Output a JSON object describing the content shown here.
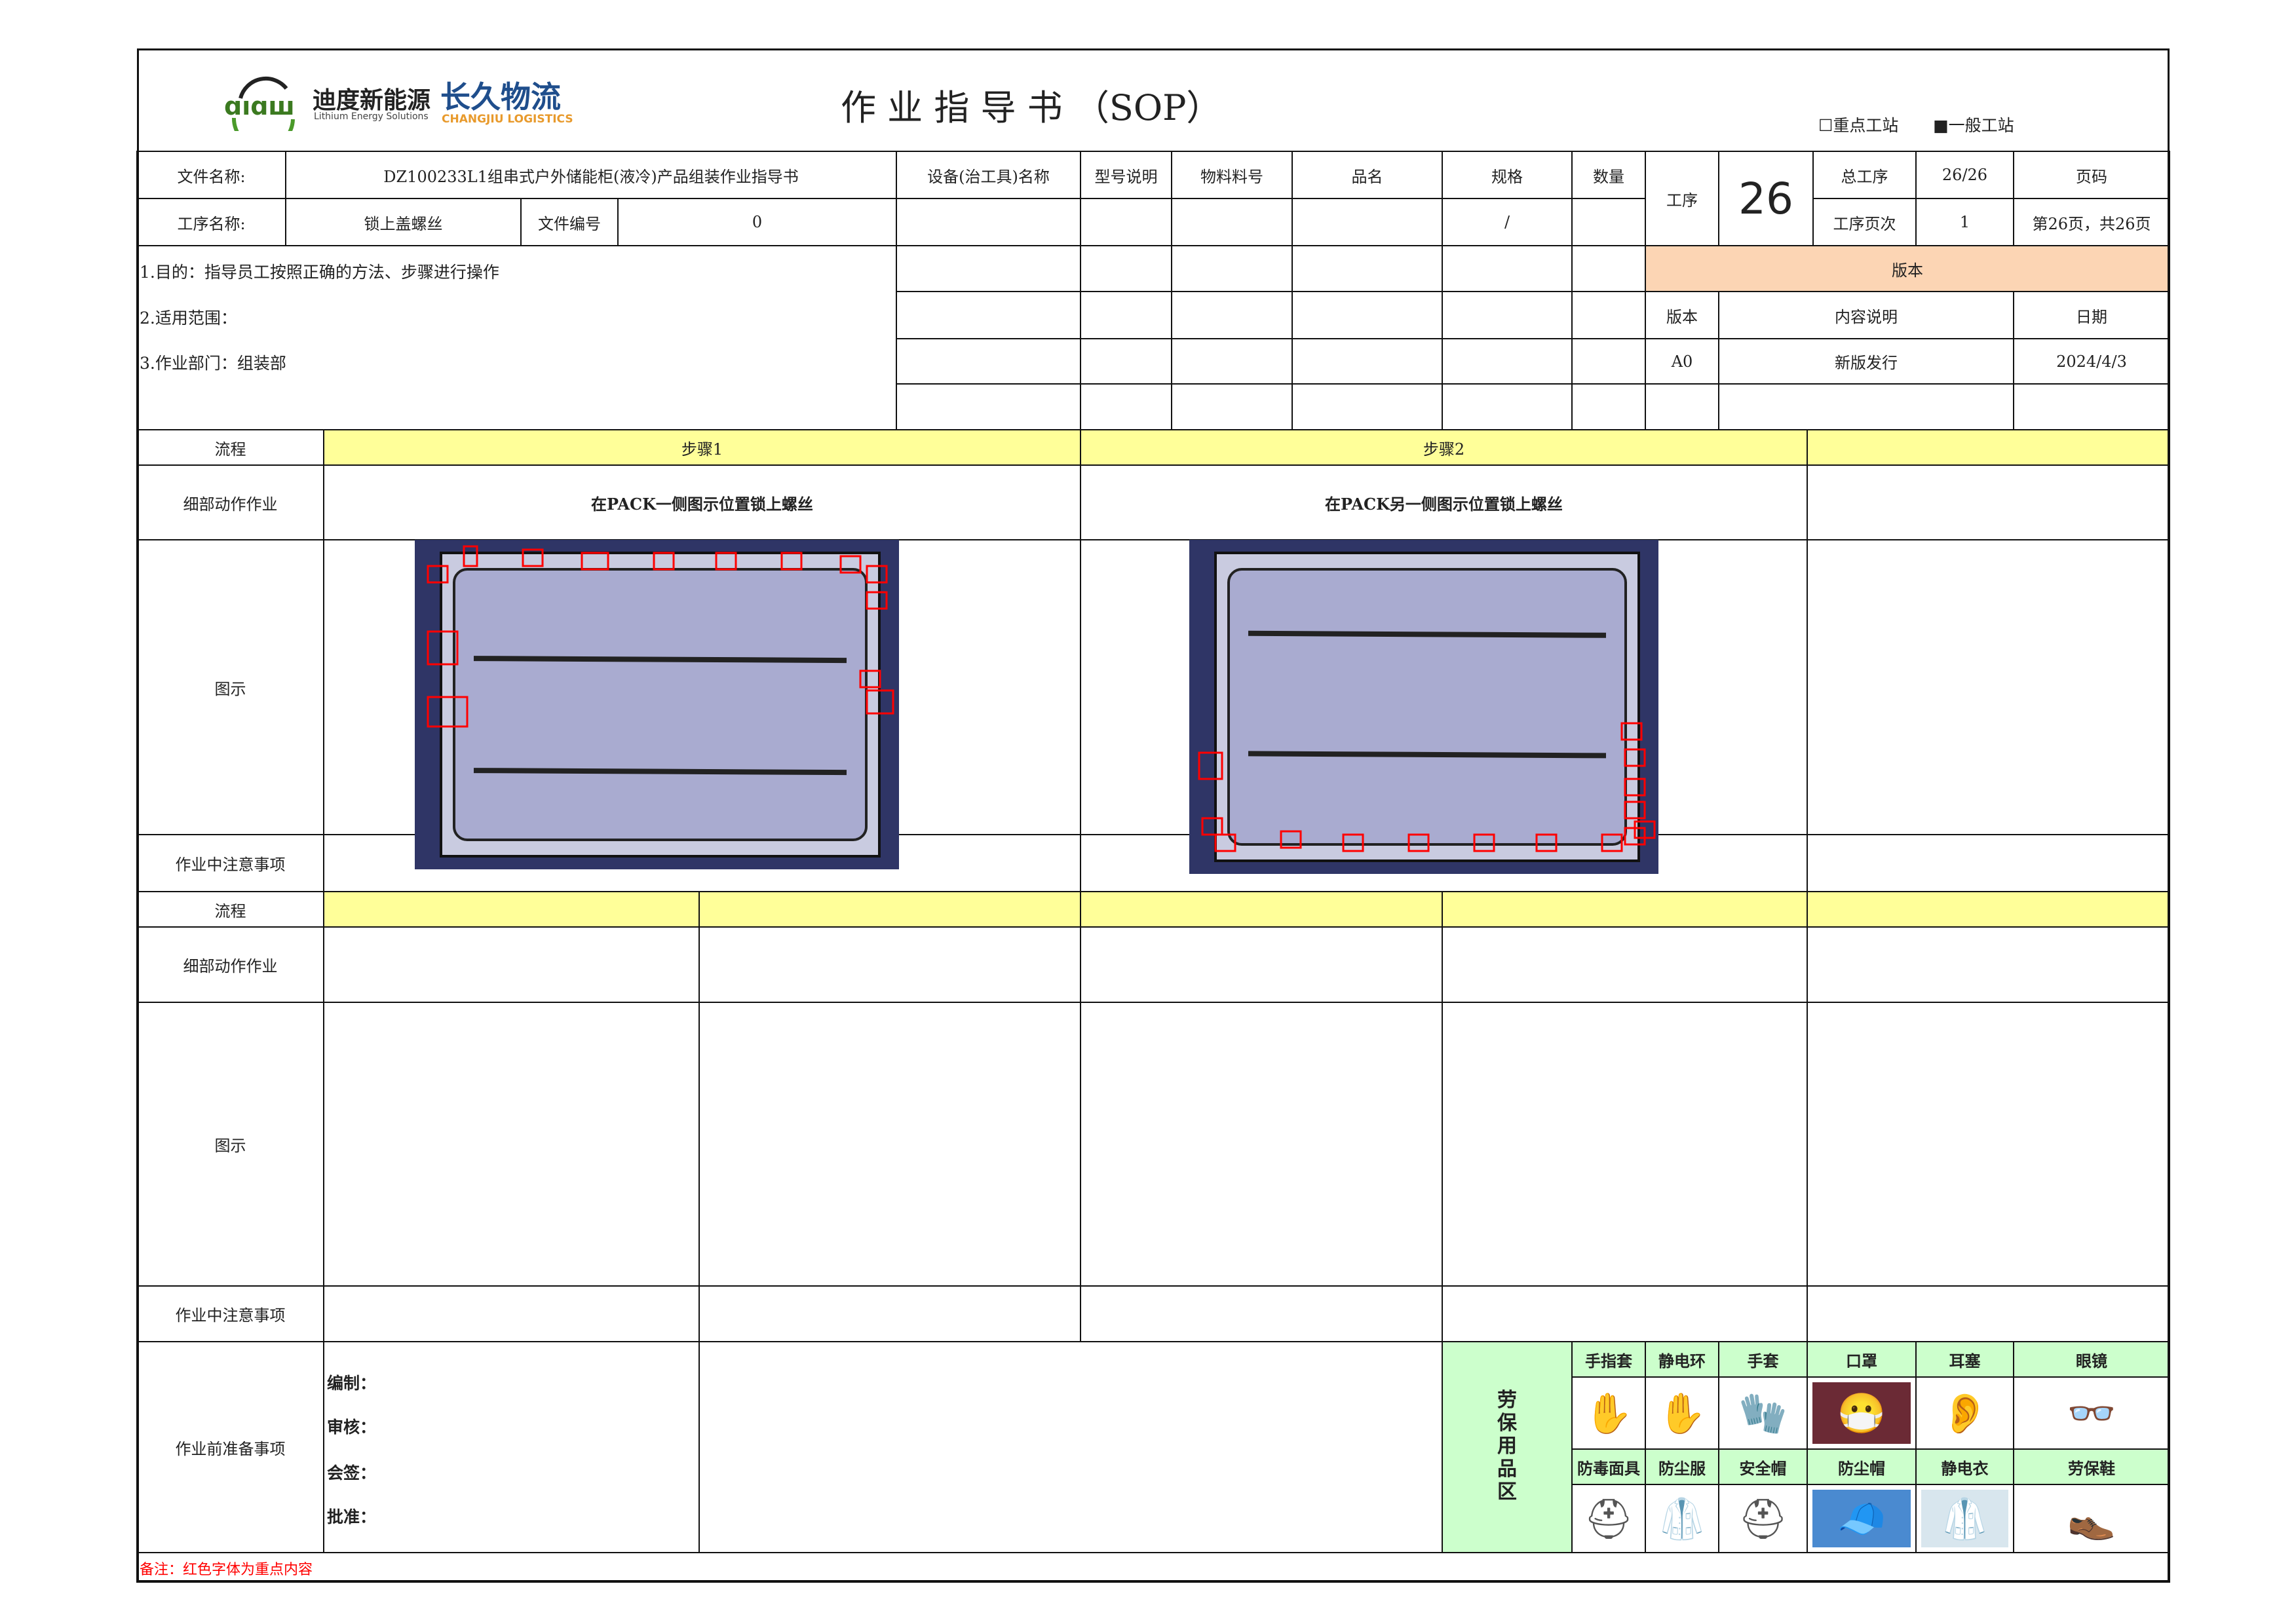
{
  "header": {
    "title": "作 业 指 导 书 （SOP）",
    "logo1_cn": "迪度新能源",
    "logo1_en": "Lithium Energy Solutions",
    "logo2_cn": "长久物流",
    "logo2_en": "CHANGJIU LOGISTICS",
    "station_key": "☐重点工站",
    "station_normal": "■一般工站"
  },
  "info": {
    "file_name_label": "文件名称:",
    "file_name": "DZ100233L1组串式户外储能柜(液冷)产品组装作业指导书",
    "process_name_label": "工序名称:",
    "process_name": "锁上盖螺丝",
    "file_no_label": "文件编号",
    "file_no": "0",
    "equip_label": "设备(治工具)名称",
    "model_label": "型号说明",
    "material_label": "物料料号",
    "part_name_label": "品名",
    "spec_label": "规格",
    "qty_label": "数量",
    "spec_value": "/",
    "step_label": "工序",
    "step_no": "26",
    "total_label": "总工序",
    "total_value": "26/26",
    "page_label": "页码",
    "step_page_label": "工序页次",
    "step_page_value": "1",
    "page_value": "第26页，共26页",
    "purpose": "1.目的：指导员工按照正确的方法、步骤进行操作",
    "scope": "2.适用范围：",
    "dept": "3.作业部门：组装部"
  },
  "version": {
    "title": "版本",
    "col_version": "版本",
    "col_content": "内容说明",
    "col_date": "日期",
    "rows": [
      {
        "version": "A0",
        "content": "新版发行",
        "date": "2024/4/3"
      }
    ]
  },
  "block1": {
    "flow_label": "流程",
    "detail_label": "细部动作作业",
    "figure_label": "图示",
    "notes_label": "作业中注意事项",
    "steps": [
      {
        "name": "步骤1",
        "action": "在PACK一侧图示位置锁上螺丝"
      },
      {
        "name": "步骤2",
        "action": "在PACK另一侧图示位置锁上螺丝"
      }
    ]
  },
  "block2": {
    "flow_label": "流程",
    "detail_label": "细部动作作业",
    "figure_label": "图示",
    "notes_label": "作业中注意事项"
  },
  "prep": {
    "label": "作业前准备事项",
    "sign": [
      "编制：",
      "审核：",
      "会签：",
      "批准："
    ]
  },
  "ppe": {
    "title": "劳保用品区",
    "row1": [
      "手指套",
      "静电环",
      "手套",
      "口罩",
      "耳塞",
      "眼镜"
    ],
    "row2": [
      "防毒面具",
      "防尘服",
      "安全帽",
      "防尘帽",
      "静电衣",
      "劳保鞋"
    ]
  },
  "note": "备注：红色字体为重点内容",
  "colors": {
    "yellow": "#ffff99",
    "peach": "#fcd5b4",
    "green": "#ccffcc",
    "red": "#ff0000"
  }
}
